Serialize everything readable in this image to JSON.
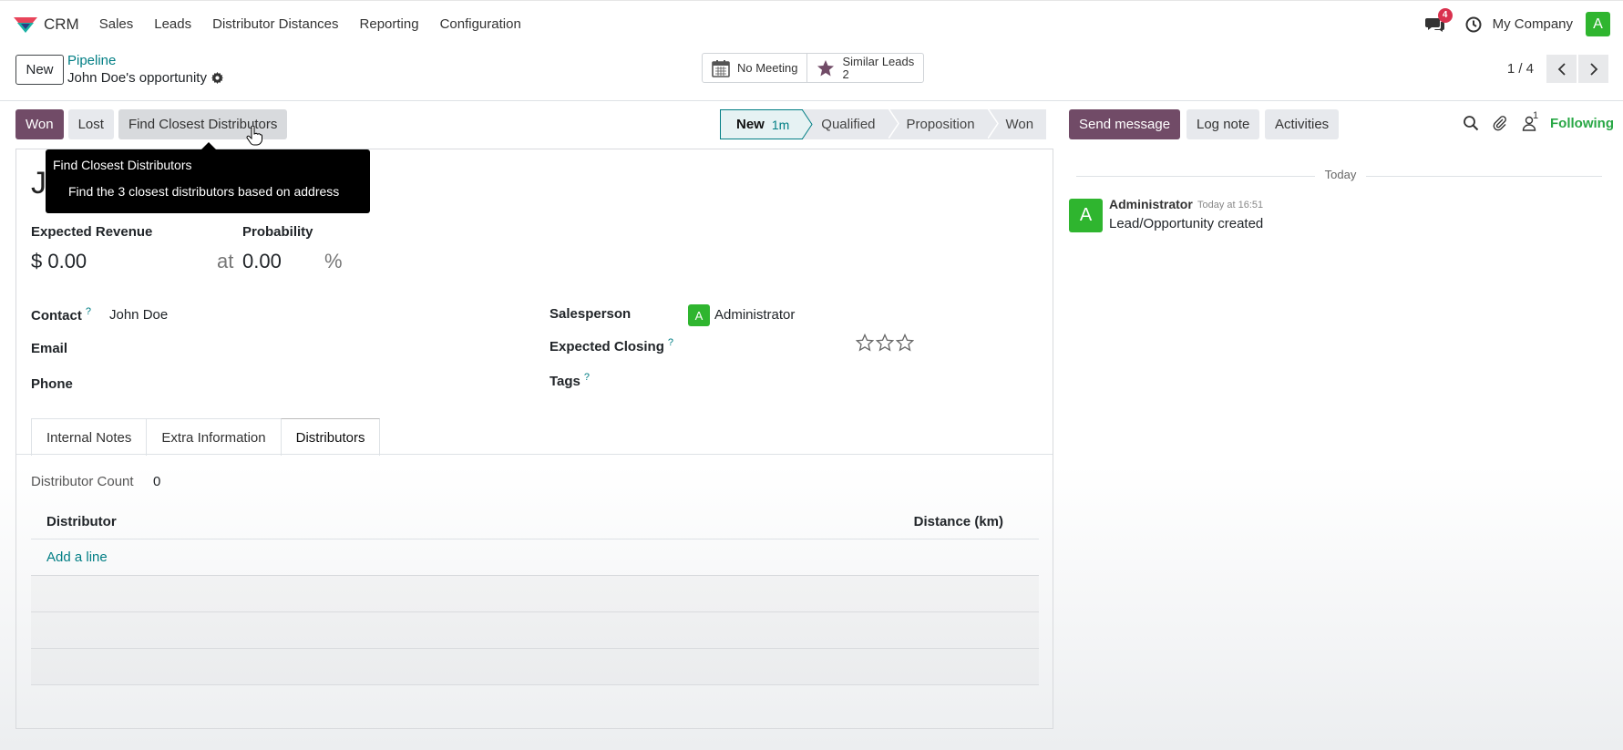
{
  "nav": {
    "app_name": "CRM",
    "menu": [
      "Sales",
      "Leads",
      "Distributor Distances",
      "Reporting",
      "Configuration"
    ],
    "chat_badge": "4",
    "company": "My Company",
    "user_initial": "A"
  },
  "control": {
    "new_label": "New",
    "breadcrumb_parent": "Pipeline",
    "breadcrumb_current": "John Doe's opportunity",
    "smart_meeting": "No Meeting",
    "smart_similar_label": "Similar Leads",
    "smart_similar_count": "2",
    "pager": "1 / 4"
  },
  "statusbar": {
    "won": "Won",
    "lost": "Lost",
    "find": "Find Closest Distributors"
  },
  "stages": [
    {
      "label": "New",
      "time": "1m"
    },
    {
      "label": "Qualified"
    },
    {
      "label": "Proposition"
    },
    {
      "label": "Won"
    }
  ],
  "tooltip": {
    "title": "Find Closest Distributors",
    "desc": "Find the 3 closest distributors based on address"
  },
  "form": {
    "title_fragment": "J",
    "expected_revenue_label": "Expected Revenue",
    "expected_revenue_value": "$ 0.00",
    "at": "at",
    "probability_label": "Probability",
    "probability_value": "0.00",
    "percent": "%",
    "contact_label": "Contact",
    "help_mark": "?",
    "contact_value": "John Doe",
    "email_label": "Email",
    "phone_label": "Phone",
    "salesperson_label": "Salesperson",
    "salesperson_initial": "A",
    "salesperson_value": "Administrator",
    "expected_closing_label": "Expected Closing",
    "tags_label": "Tags",
    "priority_stars": 0
  },
  "tabs": [
    "Internal Notes",
    "Extra Information",
    "Distributors"
  ],
  "distributors": {
    "count_label": "Distributor Count",
    "count_value": "0",
    "columns": [
      "Distributor",
      "Distance (km)"
    ],
    "add_line": "Add a line"
  },
  "chatter": {
    "send": "Send message",
    "log": "Log note",
    "activities": "Activities",
    "follower_count": "1",
    "following": "Following",
    "date_sep": "Today",
    "author_initial": "A",
    "author": "Administrator",
    "time": "Today at 16:51",
    "body": "Lead/Opportunity created"
  },
  "colors": {
    "primary": "#714b67",
    "link": "#017e84",
    "avatar": "#2fb52f",
    "badge": "#d9314e",
    "following": "#28a745"
  }
}
